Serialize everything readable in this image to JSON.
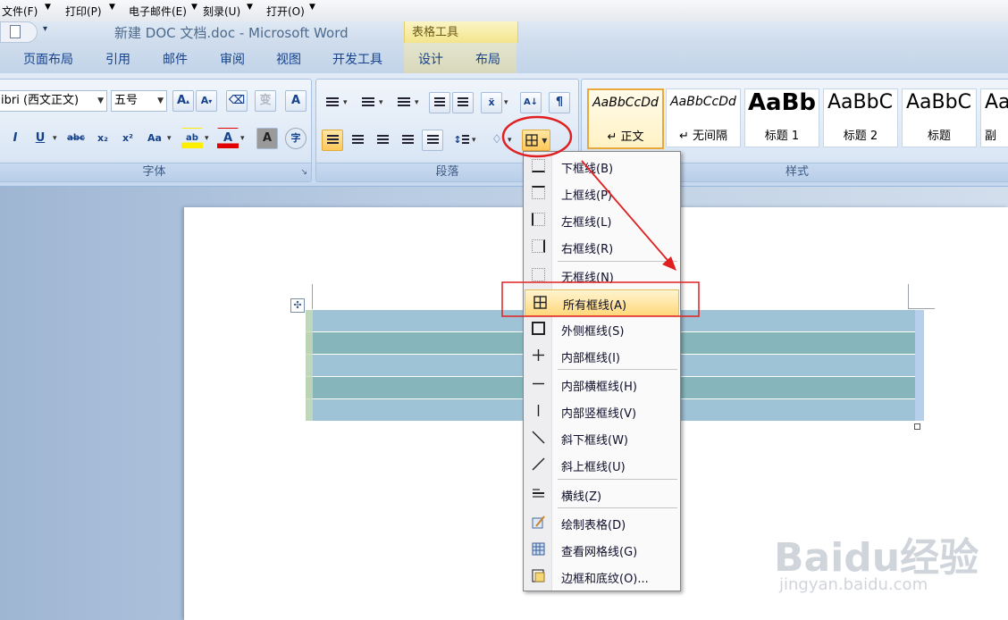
{
  "menubar": {
    "items": [
      "文件(F)",
      "打印(P)",
      "电子邮件(E)",
      "刻录(U)",
      "打开(O)"
    ]
  },
  "titlebar": {
    "title": "新建 DOC 文档.doc - Microsoft Word",
    "context_tab": "表格工具"
  },
  "tabs": [
    "页面布局",
    "引用",
    "邮件",
    "审阅",
    "视图",
    "开发工具",
    "设计",
    "布局"
  ],
  "ribbon": {
    "font_group": {
      "label": "字体",
      "font_name": "ibri (西文正文)",
      "font_size": "五号"
    },
    "paragraph_group": {
      "label": "段落"
    },
    "styles_group": {
      "label": "样式",
      "styles": [
        {
          "preview": "AaBbCcDd",
          "name": "↵ 正文"
        },
        {
          "preview": "AaBbCcDd",
          "name": "↵ 无间隔"
        },
        {
          "preview": "AaBb",
          "name": "标题 1"
        },
        {
          "preview": "AaBbC",
          "name": "标题 2"
        },
        {
          "preview": "AaBbC",
          "name": "标题"
        },
        {
          "preview": "Aa",
          "name": "副"
        }
      ]
    }
  },
  "border_menu": {
    "items": [
      {
        "label": "下框线(B)",
        "icon": "bottom-border-icon"
      },
      {
        "label": "上框线(P)",
        "icon": "top-border-icon"
      },
      {
        "label": "左框线(L)",
        "icon": "left-border-icon"
      },
      {
        "label": "右框线(R)",
        "icon": "right-border-icon"
      },
      {
        "label": "无框线(N)",
        "icon": "no-border-icon"
      },
      {
        "label": "所有框线(A)",
        "icon": "all-borders-icon"
      },
      {
        "label": "外侧框线(S)",
        "icon": "outside-borders-icon"
      },
      {
        "label": "内部框线(I)",
        "icon": "inside-borders-icon"
      },
      {
        "label": "内部横框线(H)",
        "icon": "inside-horizontal-border-icon"
      },
      {
        "label": "内部竖框线(V)",
        "icon": "inside-vertical-border-icon"
      },
      {
        "label": "斜下框线(W)",
        "icon": "diagonal-down-border-icon"
      },
      {
        "label": "斜上框线(U)",
        "icon": "diagonal-up-border-icon"
      },
      {
        "label": "横线(Z)",
        "icon": "horizontal-line-icon"
      },
      {
        "label": "绘制表格(D)",
        "icon": "draw-table-icon"
      },
      {
        "label": "查看网格线(G)",
        "icon": "view-gridlines-icon"
      },
      {
        "label": "边框和底纹(O)...",
        "icon": "borders-shading-icon"
      }
    ]
  },
  "watermark": {
    "brand": "Baidu经验",
    "url": "jingyan.baidu.com"
  },
  "colors": {
    "annotation_red": "#e02020",
    "table_row_light": "#9fc3d6",
    "table_row_dark": "#86b6bb",
    "highlight": "#ffd87b"
  }
}
